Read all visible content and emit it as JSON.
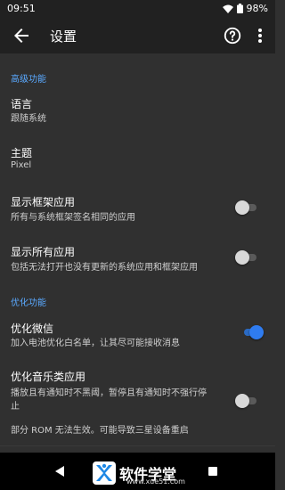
{
  "status_bar": {
    "time": "09:51",
    "battery": "98%"
  },
  "app_bar": {
    "title": "设置"
  },
  "sections": {
    "advanced": "高级功能",
    "optimize": "优化功能"
  },
  "items": {
    "language": {
      "title": "语言",
      "subtitle": "跟随系统"
    },
    "theme": {
      "title": "主题",
      "subtitle": "Pixel"
    },
    "show_framework": {
      "title": "显示框架应用",
      "subtitle": "所有与系统框架签名相同的应用",
      "enabled": false
    },
    "show_all": {
      "title": "显示所有应用",
      "subtitle": "包括无法打开也没有更新的系统应用和框架应用",
      "enabled": false
    },
    "optimize_wechat": {
      "title": "优化微信",
      "subtitle": "加入电池优化白名单，让其尽可能接收消息",
      "enabled": true
    },
    "optimize_music": {
      "title": "优化音乐类应用",
      "subtitle_line1": "播放且有通知时不黑阈，暂停且有通知时不强行停",
      "subtitle_line2": "止",
      "enabled": false
    }
  },
  "footnote": "部分 ROM 无法生效。可能导致三星设备重启",
  "watermark": {
    "name": "软件学堂",
    "site": "www.xue51.com"
  },
  "colors": {
    "accent": "#2f7cf0",
    "section": "#5aa9ff",
    "background": "#303030",
    "bar": "#212121"
  }
}
